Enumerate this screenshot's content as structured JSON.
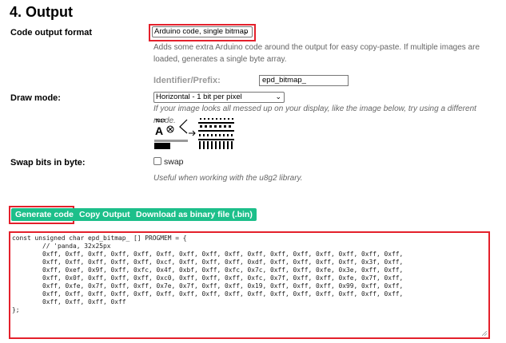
{
  "section": {
    "title": "4. Output"
  },
  "code_output_format": {
    "label": "Code output format",
    "selected": "Arduino code, single bitmap",
    "help": "Adds some extra Arduino code around the output for easy copy-paste. If multiple images are loaded, generates a single byte array."
  },
  "identifier": {
    "label": "Identifier/Prefix:",
    "value": "epd_bitmap_"
  },
  "draw_mode": {
    "label": "Draw mode:",
    "selected": "Horizontal - 1 bit per pixel",
    "help": "If your image looks all messed up on your display, like the image below, try using a different mode.",
    "illustration_text": "TEST",
    "illustration_letter": "A"
  },
  "swap_bits": {
    "label": "Swap bits in byte:",
    "checkbox_label": "swap",
    "checked": false,
    "help": "Useful when working with the u8g2 library."
  },
  "buttons": {
    "generate": "Generate code",
    "copy": "Copy Output",
    "download": "Download as binary file (.bin)"
  },
  "output": {
    "lines": [
      "const unsigned char epd_bitmap_ [] PROGMEM = {",
      "        // 'panda, 32x25px",
      "        0xff, 0xff, 0xff, 0xff, 0xff, 0xff, 0xff, 0xff, 0xff, 0xff, 0xff, 0xff, 0xff, 0xff, 0xff, 0xff,",
      "        0xff, 0xff, 0xff, 0xff, 0xff, 0xcf, 0xff, 0xff, 0xff, 0xdf, 0xff, 0xff, 0xff, 0xff, 0x3f, 0xff,",
      "        0xff, 0xef, 0x9f, 0xff, 0xfc, 0x4f, 0xbf, 0xff, 0xfc, 0x7c, 0xff, 0xff, 0xfe, 0x3e, 0xff, 0xff,",
      "        0xff, 0x0f, 0xff, 0xff, 0xff, 0xc0, 0xff, 0xff, 0xff, 0xfc, 0x7f, 0xff, 0xff, 0xfe, 0x7f, 0xff,",
      "        0xff, 0xfe, 0x7f, 0xff, 0xff, 0x7e, 0x7f, 0xff, 0xff, 0x19, 0xff, 0xff, 0xff, 0x99, 0xff, 0xff,",
      "        0xff, 0xff, 0xff, 0xff, 0xff, 0xff, 0xff, 0xff, 0xff, 0xff, 0xff, 0xff, 0xff, 0xff, 0xff, 0xff,",
      "        0xff, 0xff, 0xff, 0xff",
      "};"
    ]
  },
  "colors": {
    "accent_button": "#1dbf8a",
    "highlight_border": "#e4202b"
  }
}
